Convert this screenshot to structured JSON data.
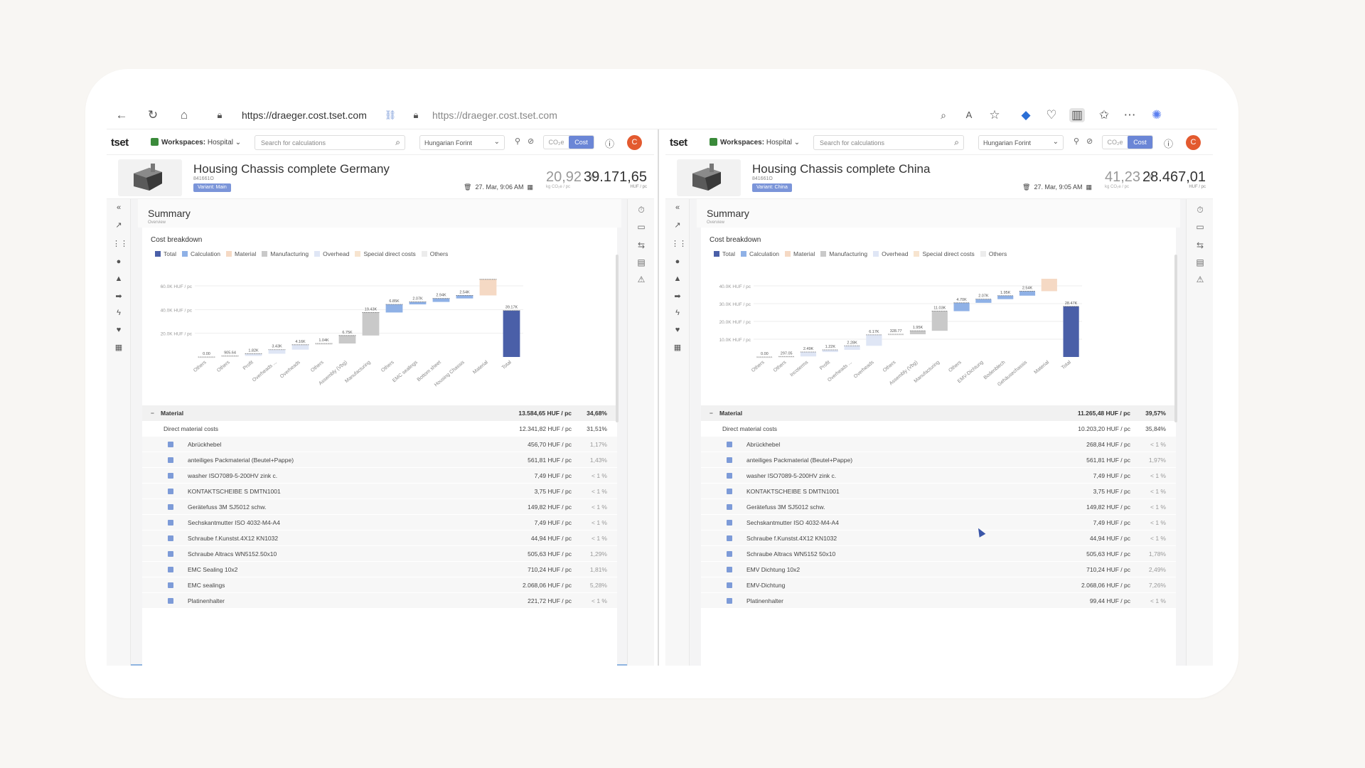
{
  "browser": {
    "url_left": "https://draeger.cost.tset.com",
    "url_right": "https://draeger.cost.tset.com",
    "icons": [
      "back-arrow-icon",
      "reload-icon",
      "home-icon",
      "lock-icon",
      "link-icon",
      "zoom-icon",
      "read-aloud-icon",
      "favorite-star-icon",
      "extension-icon",
      "browser-essentials-icon",
      "split-screen-icon",
      "favorites-icon",
      "more-icon",
      "copilot-icon"
    ]
  },
  "app": {
    "logo": "tset",
    "workspace_label": "Workspaces:",
    "workspace_value": "Hospital",
    "search_placeholder": "Search for calculations",
    "currency": "Hungarian Forint",
    "toggle_co2": "CO₂e",
    "toggle_cost": "Cost",
    "avatar_initial": "C"
  },
  "panes": [
    {
      "title": "Housing Chassis complete Germany",
      "part_id": "841661O",
      "variant": "Variant: Main",
      "date": "27. Mar, 9:06 AM",
      "co2_value": "20,92",
      "co2_unit": "kg CO₂e / pc",
      "cost_value": "39.171,65",
      "cost_unit": "HUF / pc",
      "summary_title": "Summary",
      "summary_sub": "Overview",
      "chart_title": "Cost breakdown",
      "legend": [
        "Total",
        "Calculation",
        "Material",
        "Manufacturing",
        "Overhead",
        "Special direct costs",
        "Others"
      ],
      "material": {
        "header": {
          "name": "Material",
          "value": "13.584,65 HUF / pc",
          "pct": "34,68%"
        },
        "direct": {
          "name": "Direct material costs",
          "value": "12.341,82 HUF / pc",
          "pct": "31,51%"
        },
        "items": [
          {
            "name": "Abrückhebel",
            "value": "456,70 HUF / pc",
            "pct": "1,17%"
          },
          {
            "name": "anteiliges Packmaterial (Beutel+Pappe)",
            "value": "561,81 HUF / pc",
            "pct": "1,43%"
          },
          {
            "name": "washer ISO7089-5-200HV zink c.",
            "value": "7,49 HUF / pc",
            "pct": "< 1 %"
          },
          {
            "name": "KONTAKTSCHEIBE S DMTN1001",
            "value": "3,75 HUF / pc",
            "pct": "< 1 %"
          },
          {
            "name": "Gerätefuss 3M SJ5012 schw.",
            "value": "149,82 HUF / pc",
            "pct": "< 1 %"
          },
          {
            "name": "Sechskantmutter ISO 4032-M4-A4",
            "value": "7,49 HUF / pc",
            "pct": "< 1 %"
          },
          {
            "name": "Schraube f.Kunstst.4X12 KN1032",
            "value": "44,94 HUF / pc",
            "pct": "< 1 %"
          },
          {
            "name": "Schraube Altracs WN5152.50x10",
            "value": "505,63 HUF / pc",
            "pct": "1,29%"
          },
          {
            "name": "EMC Sealing 10x2",
            "value": "710,24 HUF / pc",
            "pct": "1,81%"
          },
          {
            "name": "EMC sealings",
            "value": "2.068,06 HUF / pc",
            "pct": "5,28%"
          },
          {
            "name": "Platinenhalter",
            "value": "221,72 HUF / pc",
            "pct": "< 1 %"
          }
        ]
      }
    },
    {
      "title": "Housing Chassis complete China",
      "part_id": "841661O",
      "variant": "Variant: China",
      "date": "27. Mar, 9:05 AM",
      "co2_value": "41,23",
      "co2_unit": "kg CO₂e / pc",
      "cost_value": "28.467,01",
      "cost_unit": "HUF / pc",
      "summary_title": "Summary",
      "summary_sub": "Overview",
      "chart_title": "Cost breakdown",
      "legend": [
        "Total",
        "Calculation",
        "Material",
        "Manufacturing",
        "Overhead",
        "Special direct costs",
        "Others"
      ],
      "material": {
        "header": {
          "name": "Material",
          "value": "11.265,48 HUF / pc",
          "pct": "39,57%"
        },
        "direct": {
          "name": "Direct material costs",
          "value": "10.203,20 HUF / pc",
          "pct": "35,84%"
        },
        "items": [
          {
            "name": "Abrückhebel",
            "value": "268,84 HUF / pc",
            "pct": "< 1 %"
          },
          {
            "name": "anteiliges Packmaterial (Beutel+Pappe)",
            "value": "561,81 HUF / pc",
            "pct": "1,97%"
          },
          {
            "name": "washer ISO7089-5-200HV zink c.",
            "value": "7,49 HUF / pc",
            "pct": "< 1 %"
          },
          {
            "name": "KONTAKTSCHEIBE S DMTN1001",
            "value": "3,75 HUF / pc",
            "pct": "< 1 %"
          },
          {
            "name": "Gerätefuss 3M SJ5012 schw.",
            "value": "149,82 HUF / pc",
            "pct": "< 1 %"
          },
          {
            "name": "Sechskantmutter ISO 4032-M4-A4",
            "value": "7,49 HUF / pc",
            "pct": "< 1 %"
          },
          {
            "name": "Schraube f.Kunstst.4X12 KN1032",
            "value": "44,94 HUF / pc",
            "pct": "< 1 %"
          },
          {
            "name": "Schraube Altracs WN5152 50x10",
            "value": "505,63 HUF / pc",
            "pct": "1,78%"
          },
          {
            "name": "EMV Dichtung 10x2",
            "value": "710,24 HUF / pc",
            "pct": "2,49%"
          },
          {
            "name": "EMV-Dichtung",
            "value": "2.068,06 HUF / pc",
            "pct": "7,26%"
          },
          {
            "name": "Platinenhalter",
            "value": "99,44 HUF / pc",
            "pct": "< 1 %"
          }
        ]
      }
    }
  ],
  "colors": {
    "total": "#4a5fa8",
    "calculation": "#8fb1e6",
    "material": "#f5d9c4",
    "manufacturing": "#c9c9c9",
    "overhead": "#dfe6f5",
    "special": "#f7e4cf",
    "others": "#ececec",
    "accent": "#6b86d6",
    "avatar": "#e35a2f"
  },
  "chart_data": [
    {
      "type": "bar",
      "title": "Cost breakdown",
      "ylabel": "",
      "y_ticks": [
        "20.0K HUF / pc",
        "40.0K HUF / pc",
        "60.0K HUF / pc"
      ],
      "ylim": [
        0,
        60000
      ],
      "categories": [
        "Others",
        "Others",
        "Profit",
        "Overheads ...",
        "Overheads",
        "Others",
        "Assembly (Vbg)",
        "Manufacturing",
        "Others",
        "EMC sealings",
        "Bottom sheet",
        "Housing Chassis",
        "Material",
        "Total"
      ],
      "values": [
        0,
        905.64,
        1820,
        3430,
        4160,
        1040,
        6750,
        19430,
        6850,
        2070,
        2940,
        2540,
        13580,
        39170
      ],
      "labels": [
        "0.00",
        "905.64",
        "1.82K",
        "3.43K",
        "4.16K",
        "1.04K",
        "6.75K",
        "19.43K",
        "6.85K",
        "2.07K",
        "2.94K",
        "2.54K",
        "13.58K",
        "39.17K"
      ],
      "kinds": [
        "others",
        "others",
        "overhead",
        "overhead",
        "overhead",
        "others",
        "manufacturing",
        "manufacturing",
        "calculation",
        "calculation",
        "calculation",
        "calculation",
        "material",
        "total"
      ],
      "grid": true
    },
    {
      "type": "bar",
      "title": "Cost breakdown",
      "ylabel": "",
      "y_ticks": [
        "10.0K HUF / pc",
        "20.0K HUF / pc",
        "30.0K HUF / pc",
        "40.0K HUF / pc"
      ],
      "ylim": [
        0,
        40000
      ],
      "categories": [
        "Others",
        "Others",
        "Incoterms",
        "Profit",
        "Overheads ...",
        "Overheads",
        "Others",
        "Assembly (Vbg)",
        "Manufacturing",
        "Others",
        "EMV-Dichtung",
        "Bodenblech",
        "Gehäusechassis",
        "Material",
        "Total"
      ],
      "values": [
        0,
        297.05,
        2490,
        1220,
        2280,
        6170,
        328.77,
        1950,
        11030,
        4700,
        2070,
        1950,
        2540,
        11270,
        28470
      ],
      "labels": [
        "0.00",
        "297.05",
        "2.49K",
        "1.22K",
        "2.28K",
        "6.17K",
        "328.77",
        "1.95K",
        "11.03K",
        "4.70K",
        "2.07K",
        "1.95K",
        "2.54K",
        "11.27K",
        "28.47K"
      ],
      "kinds": [
        "others",
        "others",
        "overhead",
        "overhead",
        "overhead",
        "overhead",
        "others",
        "manufacturing",
        "manufacturing",
        "calculation",
        "calculation",
        "calculation",
        "calculation",
        "material",
        "total"
      ],
      "grid": true
    }
  ]
}
